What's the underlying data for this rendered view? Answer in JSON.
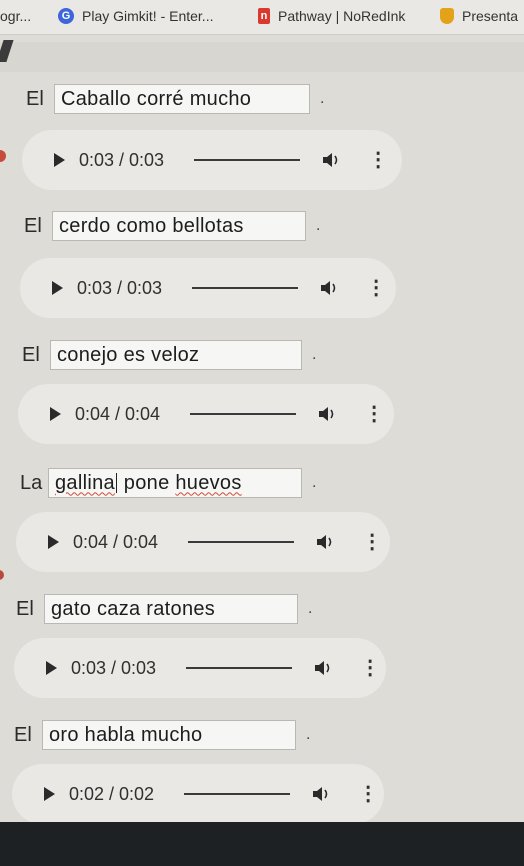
{
  "bookmarks": [
    {
      "label": "ogr...",
      "icon": "none"
    },
    {
      "label": "Play Gimkit! - Enter...",
      "icon": "gimkit-icon"
    },
    {
      "label": "Pathway | NoRedInk",
      "icon": "noredink-icon"
    },
    {
      "label": "Presenta",
      "icon": "presentation-icon"
    }
  ],
  "exercises": [
    {
      "article": "El",
      "answer": "Caballo corré mucho",
      "dot": ".",
      "audio_time": "0:03 / 0:03"
    },
    {
      "article": "El",
      "answer": "cerdo como bellotas",
      "dot": ".",
      "audio_time": "0:03 / 0:03"
    },
    {
      "article": "El",
      "answer": "conejo es veloz",
      "dot": ".",
      "audio_time": "0:04 / 0:04"
    },
    {
      "article": "La",
      "answer_parts": [
        "gallina",
        "pone",
        "huevos"
      ],
      "dot": ".",
      "audio_time": "0:04 / 0:04"
    },
    {
      "article": "El",
      "answer": "gato caza ratones",
      "dot": ".",
      "audio_time": "0:03 / 0:03"
    },
    {
      "article": "El",
      "answer": "oro habla mucho",
      "dot": ".",
      "audio_time": "0:02 / 0:02"
    }
  ],
  "icons": {
    "play": "play-icon",
    "volume": "volume-icon",
    "more": "more-options-icon"
  },
  "colors": {
    "page_bg": "#dedcd7",
    "player_bg": "#e9e8e5",
    "spell_error": "#d14a3a"
  }
}
